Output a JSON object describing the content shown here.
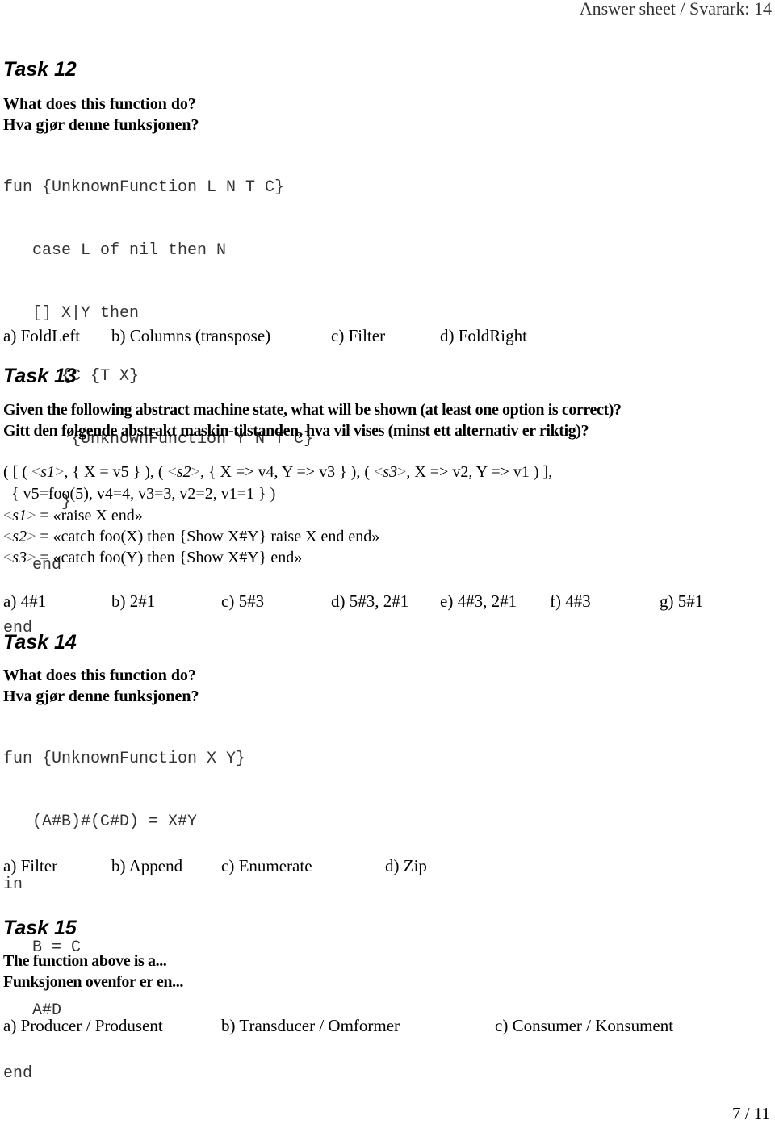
{
  "header": {
    "title": "Answer sheet / Svarark: 14"
  },
  "task12": {
    "title": "Task 12",
    "question_en": "What does this function do?",
    "question_no": "Hva gjør denne funksjonen?",
    "code": [
      "fun {UnknownFunction L N T C}",
      "   case L of nil then N",
      "   [] X|Y then",
      "      {C {T X}",
      "       {UnknownFunction Y N T C}",
      "      }",
      "   end",
      "end"
    ],
    "options": [
      "a) FoldLeft",
      "b) Columns (transpose)",
      "c) Filter",
      "d) FoldRight"
    ]
  },
  "task13": {
    "title": "Task 13",
    "question_en": "Given the following abstract machine state, what will be shown (at least one option is correct)?",
    "question_no": "Gitt den følgende abstrakt maskin-tilstanden, hva vil vises (minst ett alternativ er riktig)?",
    "state": {
      "line1": {
        "p1": "( [ ( ",
        "s1": "s1",
        "p2": ", { X = v5 } ), ( ",
        "s2": "s2",
        "p3": ", { X => v4, Y => v3 } ), ( ",
        "s3": "s3",
        "p4": ", X => v2, Y => v1 ) ],"
      },
      "line2": "  { v5=foo(5), v4=4, v3=3, v2=2, v1=1 } )",
      "defs": [
        {
          "name": "s1",
          "body": " = «raise X end»"
        },
        {
          "name": "s2",
          "body": " = «catch foo(X) then {Show X#Y} raise X end end»"
        },
        {
          "name": "s3",
          "body": " = «catch foo(Y) then {Show X#Y} end»"
        }
      ]
    },
    "options": [
      "a) 4#1",
      "b) 2#1",
      "c) 5#3",
      "d) 5#3, 2#1",
      "e) 4#3, 2#1",
      "f) 4#3",
      "g) 5#1"
    ]
  },
  "task14": {
    "title": "Task 14",
    "question_en": "What does this function do?",
    "question_no": "Hva gjør denne funksjonen?",
    "code": [
      "fun {UnknownFunction X Y}",
      "   (A#B)#(C#D) = X#Y",
      "in",
      "   B = C",
      "   A#D",
      "end"
    ],
    "options": [
      "a) Filter",
      "b) Append",
      "c) Enumerate",
      "d) Zip"
    ]
  },
  "task15": {
    "title": "Task 15",
    "question_en": "The function above is a...",
    "question_no": "Funksjonen ovenfor er en...",
    "options": [
      "a) Producer / Produsent",
      "b) Transducer / Omformer",
      "c) Consumer / Konsument"
    ]
  },
  "footer": {
    "page": "7 / 11"
  },
  "symbols": {
    "lt": "<",
    "gt": ">"
  }
}
